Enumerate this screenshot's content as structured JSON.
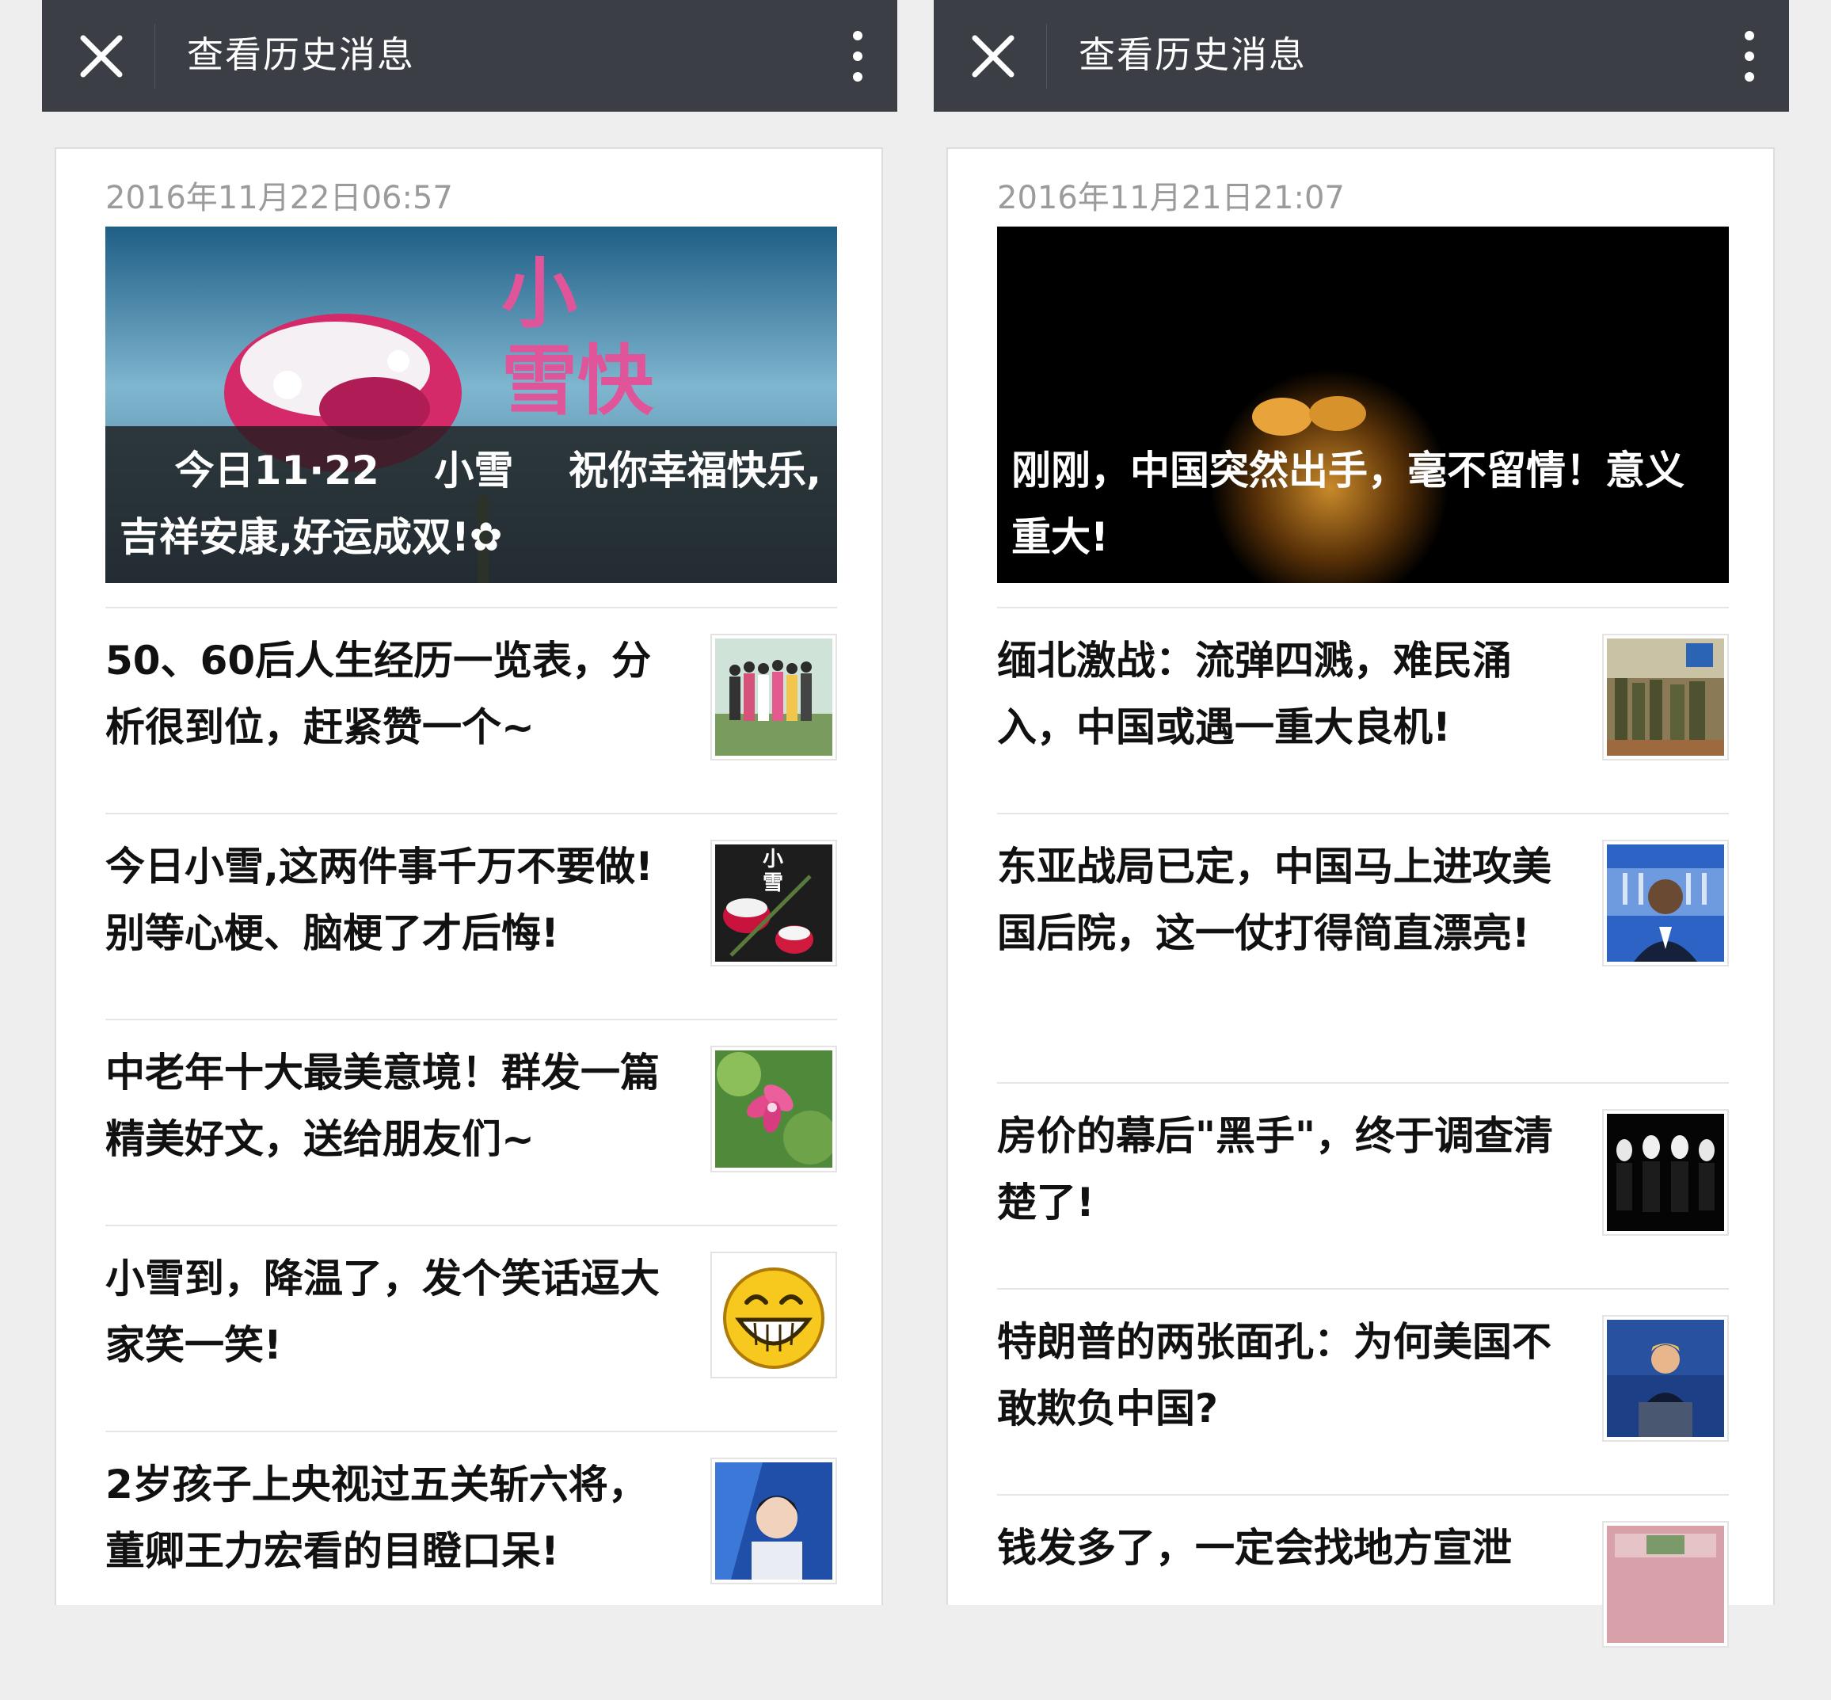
{
  "left_panel": {
    "header": {
      "title": "查看历史消息",
      "close_icon": "close-icon",
      "menu_icon": "more-vertical-icon"
    },
    "date": "2016年11月22日06:57",
    "cover": {
      "overlay_text": "小\n雪快",
      "caption": "    今日11·22    小雪    祝你幸福快乐,吉祥安康,好运成双!✿"
    },
    "articles": [
      {
        "title": "50、60后人生经历一览表，分析很到位，赶紧赞一个~",
        "thumb": "group-photo"
      },
      {
        "title": "今日小雪,这两件事千万不要做!别等心梗、脑梗了才后悔!",
        "thumb": "snow-flower",
        "thumb_text": "小雪"
      },
      {
        "title": "中老年十大最美意境！群发一篇精美好文，送给朋友们~",
        "thumb": "pink-flower"
      },
      {
        "title": "小雪到，降温了，发个笑话逗大家笑一笑!",
        "thumb": "laughing-emoji"
      },
      {
        "title": "2岁孩子上央视过五关斩六将，董卿王力宏看的目瞪口呆!",
        "thumb": "tv-host"
      }
    ]
  },
  "right_panel": {
    "header": {
      "title": "查看历史消息",
      "close_icon": "close-icon",
      "menu_icon": "more-vertical-icon"
    },
    "date": "2016年11月21日21:07",
    "cover": {
      "caption": "刚刚，中国突然出手，毫不留情！意义重大!"
    },
    "articles": [
      {
        "title": "缅北激战：流弹四溅，难民涌入，中国或遇一重大良机!",
        "thumb": "soldiers"
      },
      {
        "title": "东亚战局已定，中国马上进攻美国后院，这一仗打得简直漂亮!",
        "thumb": "white-house-speaker"
      },
      {
        "title": "房价的幕后\"黑手\"，终于调查清楚了!",
        "thumb": "masked-men"
      },
      {
        "title": "特朗普的两张面孔：为何美国不敢欺负中国?",
        "thumb": "debate-podium"
      },
      {
        "title": "钱发多了，一定会找地方宣泄",
        "thumb": "money"
      }
    ]
  },
  "colors": {
    "topbar": "#3b3e45",
    "background": "#eeeeee",
    "date_text": "#9b9b9b",
    "title_text": "#111111"
  }
}
